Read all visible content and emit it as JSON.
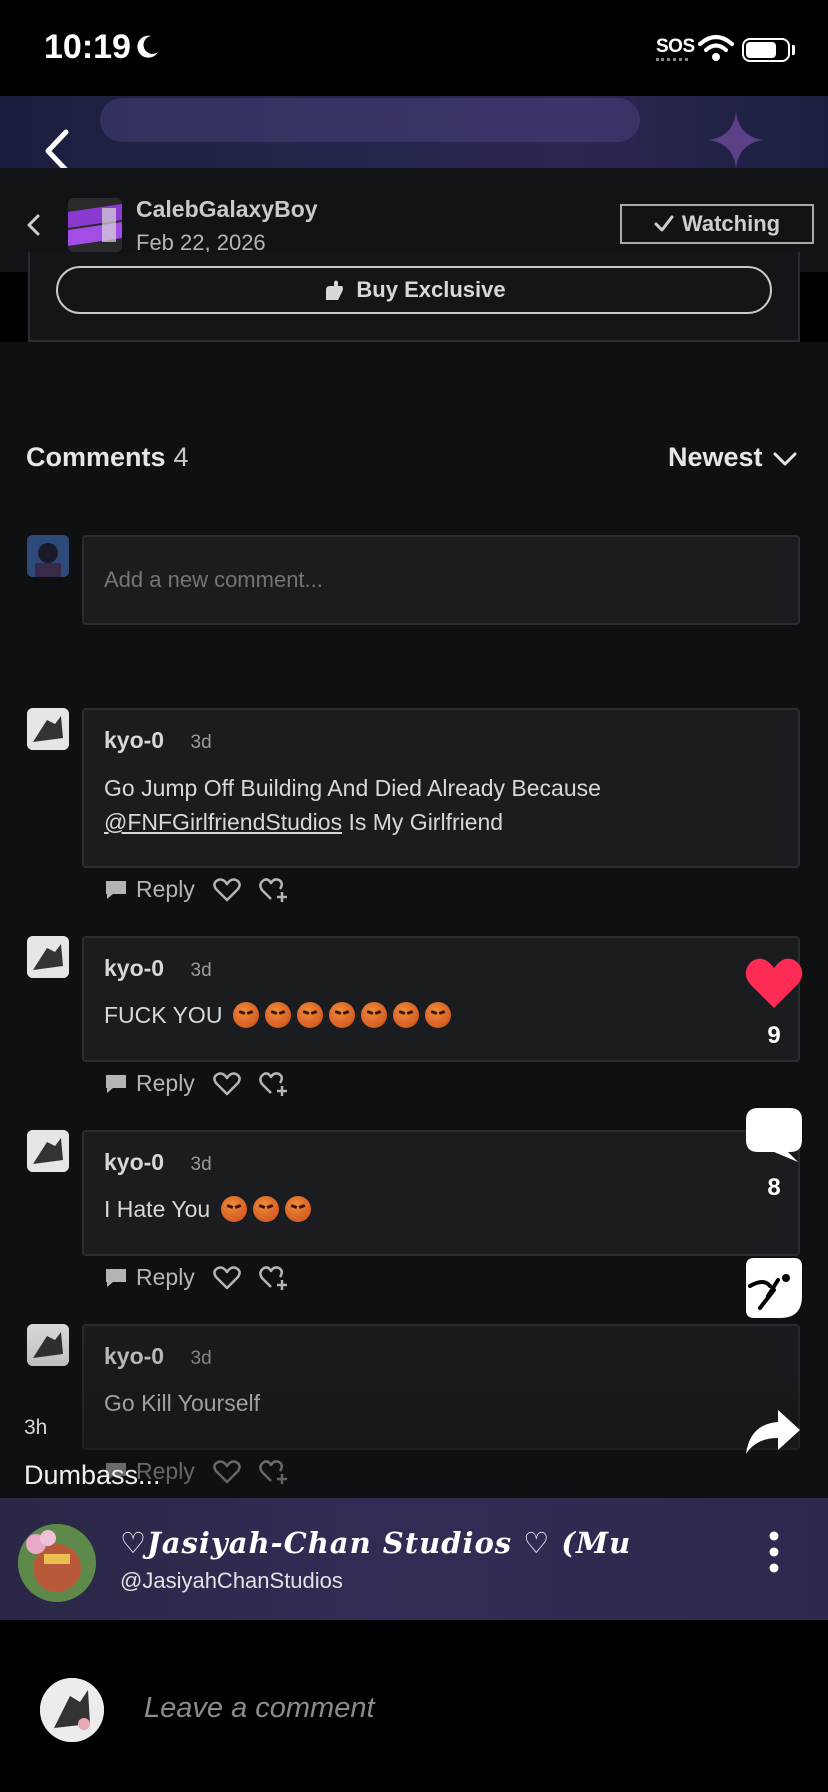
{
  "status_bar": {
    "time": "10:19",
    "sos": "SOS"
  },
  "creator": {
    "name": "CalebGalaxyBoy",
    "date": "Feb 22, 2026",
    "watching_label": "Watching",
    "buy_label": "Buy Exclusive"
  },
  "comments_section": {
    "title": "Comments",
    "count": "4",
    "sort_label": "Newest",
    "input_placeholder": "Add a new comment..."
  },
  "comments": [
    {
      "user": "kyo-0",
      "time": "3d",
      "text_line1": "Go Jump Off Building And Died Already Because",
      "mention": "@FNFGirlfriendStudios",
      "text_line2": " Is My Girlfriend",
      "reply": "Reply"
    },
    {
      "user": "kyo-0",
      "time": "3d",
      "text": "FUCK YOU",
      "emoji_count": 7,
      "reply": "Reply"
    },
    {
      "user": "kyo-0",
      "time": "3d",
      "text": "I Hate You",
      "emoji_count": 3,
      "reply": "Reply"
    },
    {
      "user": "kyo-0",
      "time": "3d",
      "text": "Go Kill Yourself",
      "reply": "Reply"
    }
  ],
  "video": {
    "like_count": "9",
    "comment_count": "8",
    "time_ago": "3h",
    "caption": "Dumbass..."
  },
  "profile": {
    "name": "♡Jasiyah-Chan Studios ♡ (Mu",
    "handle": "@JasiyahChanStudios"
  },
  "bottom_bar": {
    "placeholder": "Leave a comment"
  },
  "colors": {
    "heart": "#fe2c55",
    "background": "#0f1012",
    "banner": "#23254a"
  },
  "icons": [
    "moon-icon",
    "wifi-icon",
    "battery-icon",
    "back-arrow-icon",
    "check-icon",
    "hand-icon",
    "chevron-down-icon",
    "reply-icon",
    "heart-icon",
    "super-like-icon",
    "comment-bubble-icon",
    "sticker-icon",
    "share-icon",
    "more-icon"
  ]
}
